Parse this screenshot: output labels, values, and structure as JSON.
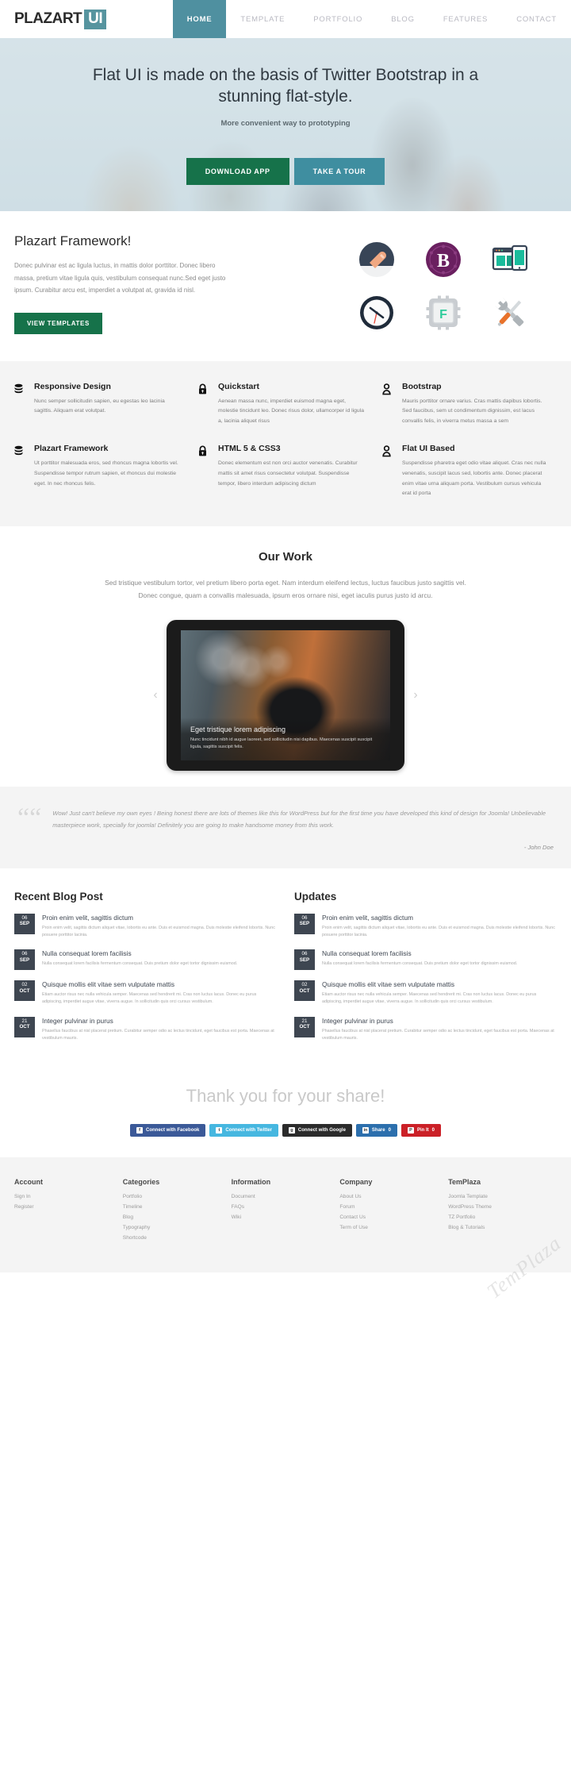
{
  "header": {
    "logo_main": "PLAZART",
    "logo_badge": "UI",
    "nav": [
      {
        "label": "HOME",
        "active": true
      },
      {
        "label": "TEMPLATE",
        "active": false
      },
      {
        "label": "PORTFOLIO",
        "active": false
      },
      {
        "label": "BLOG",
        "active": false
      },
      {
        "label": "FEATURES",
        "active": false
      },
      {
        "label": "CONTACT",
        "active": false
      }
    ]
  },
  "hero": {
    "title": "Flat UI is made on the basis of Twitter Bootstrap in a stunning flat-style.",
    "subtitle": "More convenient way to prototyping",
    "primary_button": "DOWNLOAD APP",
    "secondary_button": "TAKE A TOUR",
    "primary_color": "#16724a",
    "secondary_color": "#3f8ea0"
  },
  "framework": {
    "title": "Plazart Framework!",
    "text": "Donec pulvinar est ac ligula luctus, in mattis dolor porttitor. Donec libero massa, pretium vitae ligula quis, vestibulum consequat nunc.Sed eget justo ipsum. Curabitur arcu est, imperdiet a volutpat at, gravida id nisl.",
    "button": "VIEW TEMPLATES",
    "icons": [
      {
        "name": "mouse-icon"
      },
      {
        "name": "bootstrap-b-icon"
      },
      {
        "name": "responsive-devices-icon"
      },
      {
        "name": "clock-icon"
      },
      {
        "name": "cpu-chip-icon"
      },
      {
        "name": "tools-icon"
      }
    ]
  },
  "features": [
    {
      "icon": "database-icon",
      "title": "Responsive Design",
      "text": "Nunc semper sollicitudin sapien, eu egestas leo lacinia sagittis. Aliquam erat volutpat."
    },
    {
      "icon": "lock-icon",
      "title": "Quickstart",
      "text": "Aenean massa nunc, imperdiet euismod magna eget, molestie tincidunt leo. Donec risus dolor, ullamcorper id ligula a, lacinia aliquet risus"
    },
    {
      "icon": "user-icon",
      "title": "Bootstrap",
      "text": "Mauris porttitor ornare varius. Cras mattis dapibus lobortis. Sed faucibus, sem ut condimentum dignissim, est lacus convallis felis, in viverra metus massa a sem"
    },
    {
      "icon": "database-icon",
      "title": "Plazart Framework",
      "text": "Ut porttitor malesuada eros, sed rhoncus magna lobortis vel. Suspendisse tempor rutrum sapien, et rhoncus dui molestie eget. In nec rhoncus felis."
    },
    {
      "icon": "lock-icon",
      "title": "HTML 5 & CSS3",
      "text": "Donec elementum est non orci auctor venenatis. Curabitur mattis sit amet risus consectetur volutpat. Suspendisse tempor, libero interdum adipiscing dictum"
    },
    {
      "icon": "user-icon",
      "title": "Flat UI Based",
      "text": "Suspendisse pharetra eget odio vitae aliquet. Cras nec nulla venenatis, suscipit lacus sed, lobortis ante. Donec placerat enim vitae urna aliquam porta. Vestibulum cursus vehicula erat id porta"
    }
  ],
  "work": {
    "title": "Our Work",
    "text": "Sed tristique vestibulum tortor, vel pretium libero porta eget. Nam interdum eleifend lectus, luctus faucibus justo sagittis vel. Donec congue, quam a convallis malesuada, ipsum eros ornare nisi, eget iaculis purus justo id arcu.",
    "prev_icon": "chevron-left-icon",
    "next_icon": "chevron-right-icon",
    "slide_title": "Eget tristique lorem adipiscing",
    "slide_text": "Nunc tincidunt nibh id augue laoreet, sed sollicitudin nisi dapibus. Maecenas suscipit suscipit ligula, sagittis suscipit felis."
  },
  "testimonial": {
    "quote_icon": "quote-mark-icon",
    "text": "Wow! Just can't believe my own eyes ! Being honest there are lots of themes like this for WordPress but for the first time you have developed this kind of design for Joomla! Unbelievable masterpiece work, specially for joomla! Definitely you are going to make handsome money from this work.",
    "author": "- John Doe"
  },
  "blog": {
    "left_heading": "Recent Blog Post",
    "right_heading": "Updates",
    "posts": [
      {
        "day": "06",
        "month": "SEP",
        "title": "Proin enim velit, sagittis dictum",
        "text": "Proin enim velit, sagittis dictum aliquet vitae, lobortis eu ante. Duis et euismod magna. Duis molestie eleifend lobortis.  Nunc posuere porttitor lacinia."
      },
      {
        "day": "06",
        "month": "SEP",
        "title": "Nulla consequat lorem facilisis",
        "text": "Nulla consequat lorem facilisis fermentum consequat. Duis pretium dolor eget tortor dignissim euismod."
      },
      {
        "day": "02",
        "month": "OCT",
        "title": "Quisque mollis elit vitae sem vulputate mattis",
        "text": "Etiam auctor risus nec nulla vehicula semper. Maecenas sed hendrerit mi. Cras non luctus lacus. Donec eu purus adipiscing, imperdiet augue vitae, viverra augue. In sollicitudin quis orci cursus vestibulum."
      },
      {
        "day": "21",
        "month": "OCT",
        "title": "Integer pulvinar in purus",
        "text": "Phasellus faucibus at nisl placerat pretium. Curabitur semper odio ac lectus tincidunt, eget faucibus est porta. Maecenas at vestibulum mauris."
      }
    ]
  },
  "share": {
    "title": "Thank you for your share!",
    "buttons": [
      {
        "label": "Connect with Facebook",
        "icon": "facebook-icon",
        "count": ""
      },
      {
        "label": "Connect with Twitter",
        "icon": "twitter-icon",
        "count": ""
      },
      {
        "label": "Connect with Google",
        "icon": "google-icon",
        "count": ""
      },
      {
        "label": "Share",
        "icon": "linkedin-icon",
        "count": "0"
      },
      {
        "label": "Pin It",
        "icon": "pinterest-icon",
        "count": "0"
      }
    ]
  },
  "footer": {
    "columns": [
      {
        "heading": "Account",
        "links": [
          "Sign In",
          "Register"
        ]
      },
      {
        "heading": "Categories",
        "links": [
          "Portfolio",
          "Timeline",
          "Blog",
          "Typography",
          "Shortcode"
        ]
      },
      {
        "heading": "Information",
        "links": [
          "Document",
          "FAQs",
          "Wiki"
        ]
      },
      {
        "heading": "Company",
        "links": [
          "About Us",
          "Forum",
          "Contact Us",
          "Term of Use"
        ]
      },
      {
        "heading": "TemPlaza",
        "links": [
          "Joomla Template",
          "WordPress Theme",
          "TZ Portfolio",
          "Blog & Tutorials"
        ]
      }
    ],
    "watermark": "TemPlaza"
  }
}
